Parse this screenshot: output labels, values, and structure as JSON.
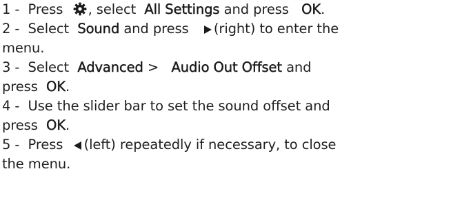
{
  "steps": [
    {
      "number": "1 -",
      "before": "Press",
      "icon": "gear-icon",
      "middle": ", select",
      "highlight1": "All Settings",
      "after": "and press",
      "highlight2": "OK",
      "end": "."
    },
    {
      "number": "2 -",
      "before": "Select",
      "highlight1": "Sound",
      "middle": "and press",
      "icon": "right-arrow-icon",
      "after": "(right) to enter the",
      "continuation": "menu."
    },
    {
      "number": "3 -",
      "before": "Select",
      "highlight1": "Advanced",
      "separator": ">",
      "highlight2": "Audio Out Offset",
      "after": "and",
      "continuation_before": "press",
      "continuation_highlight": "OK",
      "continuation_end": "."
    },
    {
      "number": "4 -",
      "text": "Use the slider bar to set the sound offset and",
      "continuation_before": "press",
      "continuation_highlight": "OK",
      "continuation_end": "."
    },
    {
      "number": "5 -",
      "before": "Press",
      "icon": "left-arrow-icon",
      "after": "(left) repeatedly if necessary, to close",
      "continuation": "the menu."
    }
  ],
  "colors": {
    "text": "#1f1f1f",
    "icon": "#1b1b1b"
  }
}
